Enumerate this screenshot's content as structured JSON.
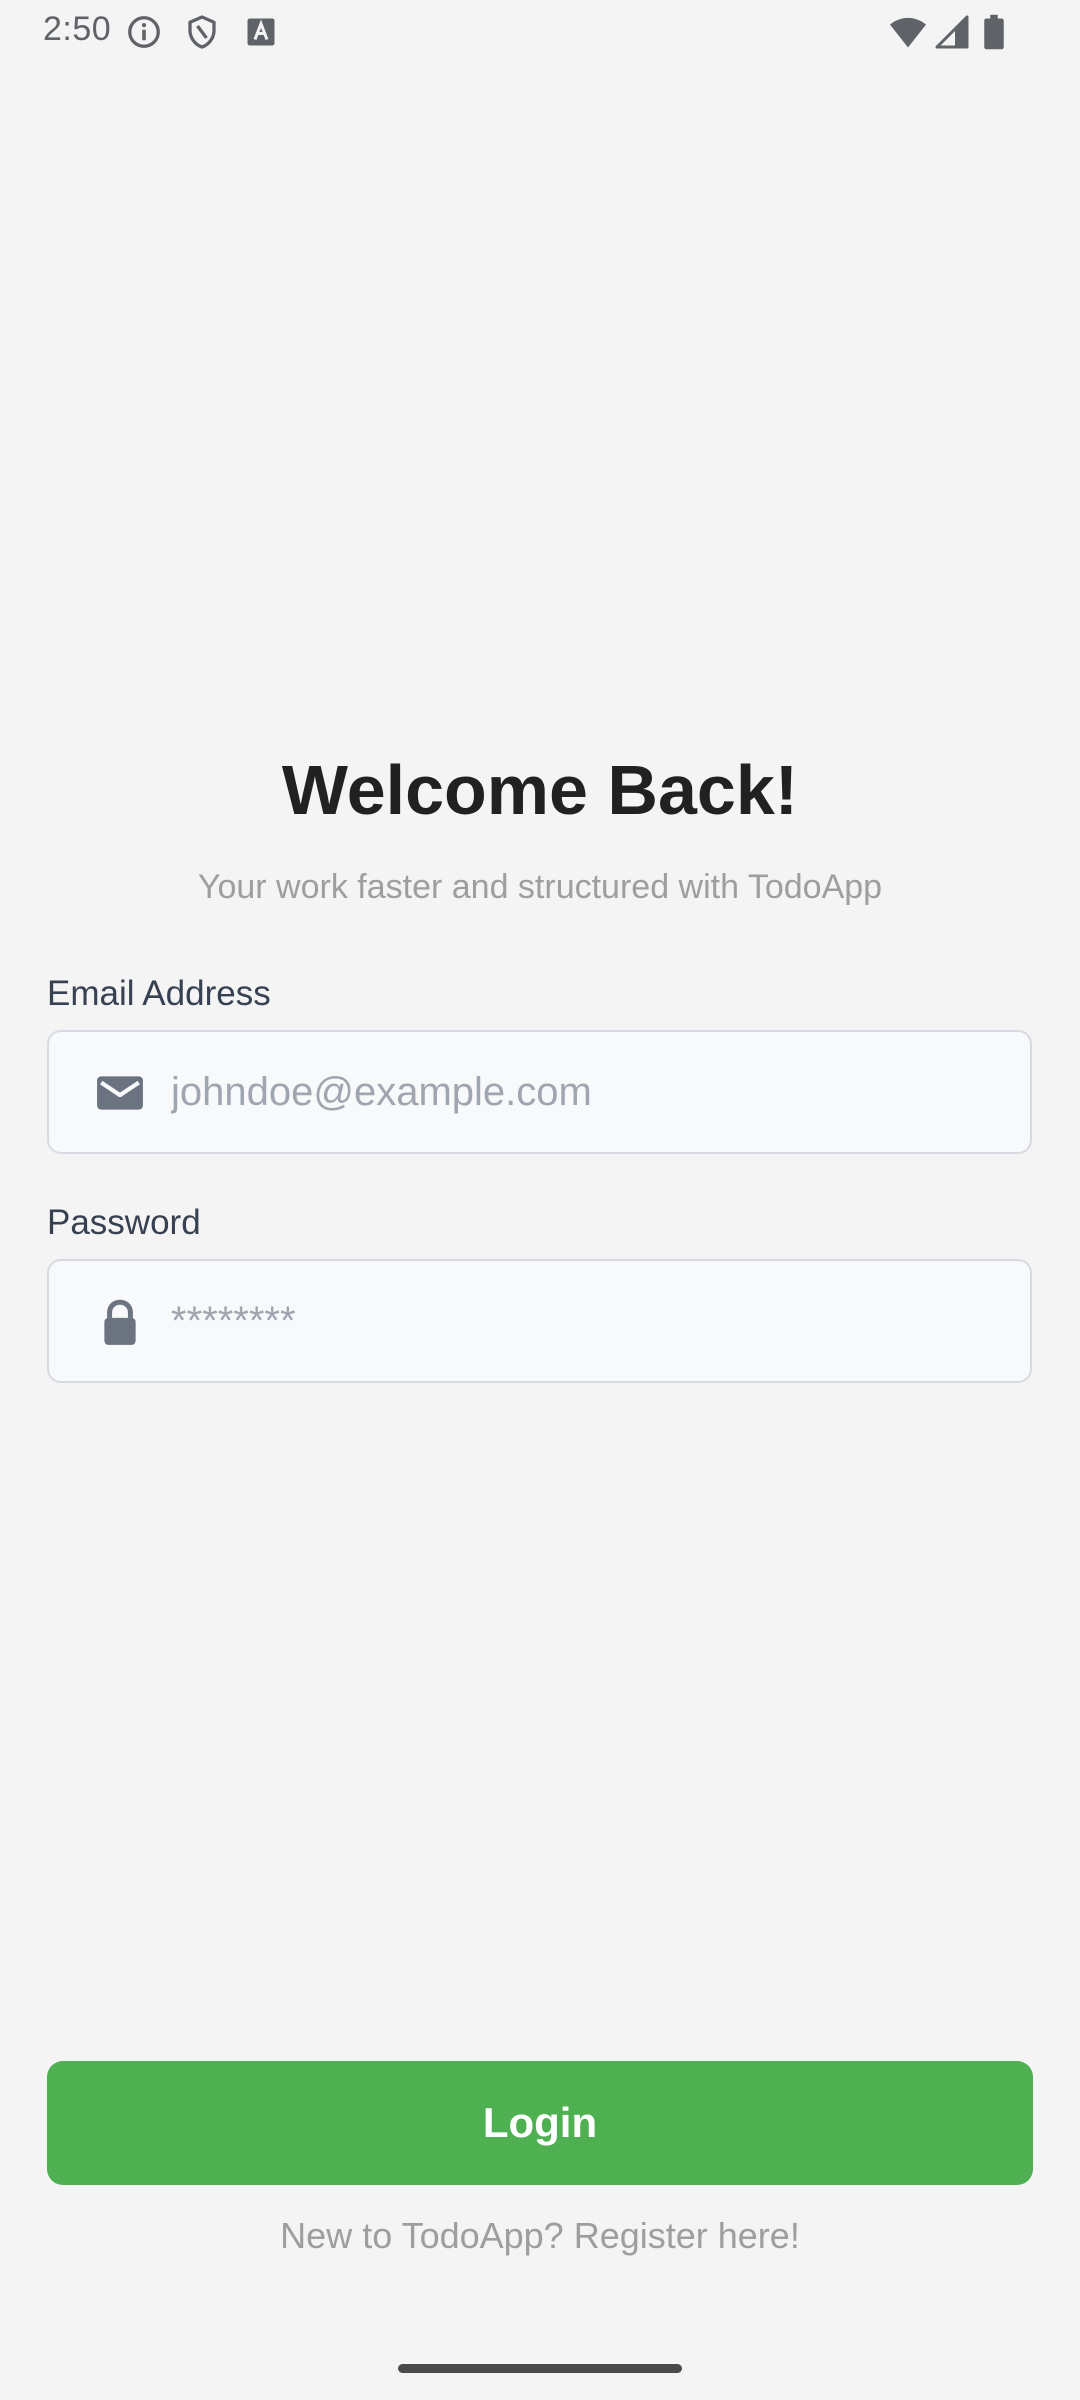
{
  "status_bar": {
    "time": "2:50",
    "left_icons": [
      "info-icon",
      "shield-icon",
      "accessibility-a-icon"
    ],
    "right_icons": [
      "wifi-icon",
      "cellular-signal-icon",
      "battery-icon"
    ]
  },
  "login": {
    "title": "Welcome Back!",
    "subtitle": "Your work faster and structured with TodoApp",
    "email": {
      "label": "Email Address",
      "placeholder": "johndoe@example.com",
      "value": "",
      "icon": "envelope-icon"
    },
    "password": {
      "label": "Password",
      "placeholder": "********",
      "value": "",
      "icon": "lock-icon"
    },
    "login_button": "Login",
    "register_prompt": "New to TodoApp? Register here!"
  },
  "colors": {
    "background": "#f4f4f4",
    "accent": "#4fb052",
    "title_text": "#212121",
    "muted_text": "#9e9e9e",
    "field_background": "#f8f9fb",
    "field_border": "#d7dae0",
    "icon": "#6b7280"
  }
}
